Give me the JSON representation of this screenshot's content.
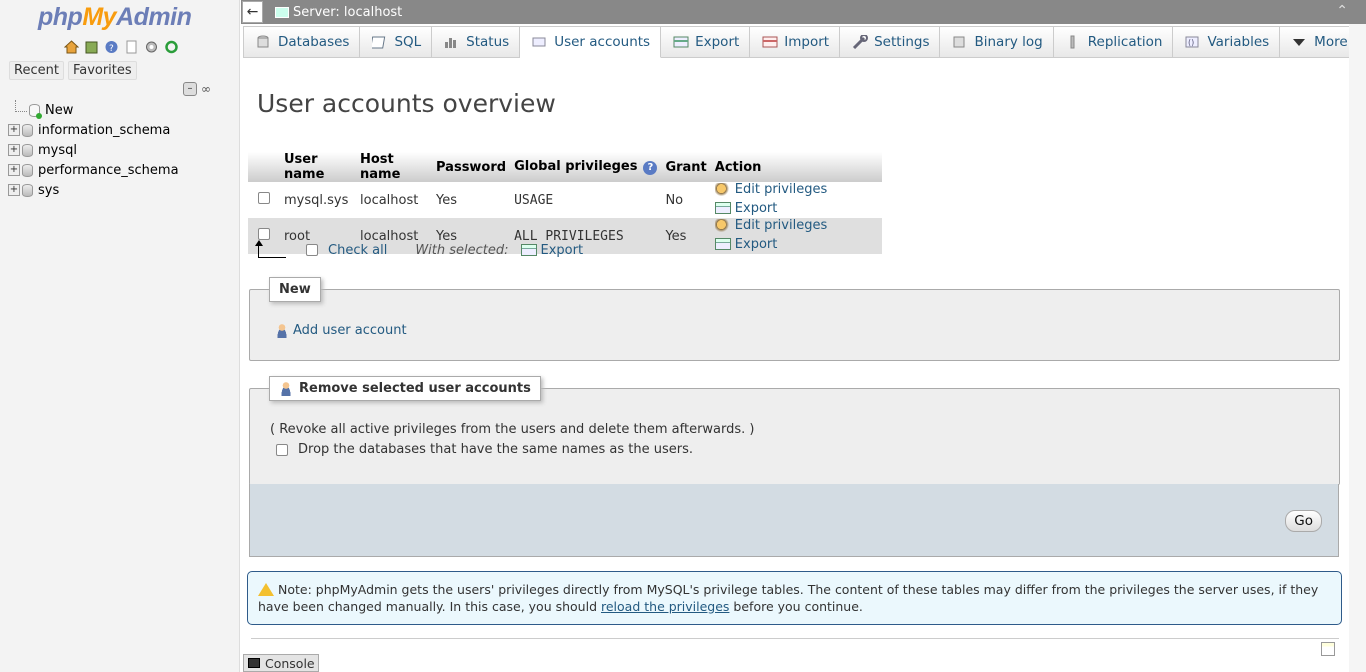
{
  "sidebar": {
    "logo": {
      "php": "php",
      "my": "My",
      "admin": "Admin"
    },
    "nav_icons": [
      "home-icon",
      "database-icon",
      "help-icon",
      "document-icon",
      "gear-icon",
      "reload-icon"
    ],
    "recent_label": "Recent",
    "favorites_label": "Favorites",
    "tree": [
      {
        "label": "New",
        "kind": "new"
      },
      {
        "label": "information_schema",
        "kind": "db"
      },
      {
        "label": "mysql",
        "kind": "db"
      },
      {
        "label": "performance_schema",
        "kind": "db"
      },
      {
        "label": "sys",
        "kind": "db"
      }
    ]
  },
  "topbar": {
    "server": "Server: localhost",
    "collapse_glyph": "←",
    "close_glyph": "⌃"
  },
  "tabs": [
    {
      "label": "Databases",
      "icon": "databases-icon"
    },
    {
      "label": "SQL",
      "icon": "sql-icon"
    },
    {
      "label": "Status",
      "icon": "status-icon"
    },
    {
      "label": "User accounts",
      "icon": "users-icon",
      "active": true
    },
    {
      "label": "Export",
      "icon": "export-icon"
    },
    {
      "label": "Import",
      "icon": "import-icon"
    },
    {
      "label": "Settings",
      "icon": "wrench-icon"
    },
    {
      "label": "Binary log",
      "icon": "binlog-icon"
    },
    {
      "label": "Replication",
      "icon": "replication-icon"
    },
    {
      "label": "Variables",
      "icon": "variables-icon"
    },
    {
      "label": "More",
      "icon": "caret-down-icon"
    }
  ],
  "page_title": "User accounts overview",
  "table": {
    "headers": [
      "User name",
      "Host name",
      "Password",
      "Global privileges",
      "Grant",
      "Action"
    ],
    "rows": [
      {
        "user": "mysql.sys",
        "host": "localhost",
        "password": "Yes",
        "privileges": "USAGE",
        "grant": "No"
      },
      {
        "user": "root",
        "host": "localhost",
        "password": "Yes",
        "privileges": "ALL PRIVILEGES",
        "grant": "Yes"
      }
    ],
    "edit_label": "Edit privileges",
    "export_label": "Export"
  },
  "bulk": {
    "check_all": "Check all",
    "with_selected": "With selected:",
    "export": "Export"
  },
  "new_section": {
    "legend": "New",
    "add_user": "Add user account"
  },
  "remove_section": {
    "legend": "Remove selected user accounts",
    "description": "( Revoke all active privileges from the users and delete them afterwards. )",
    "drop_label": "Drop the databases that have the same names as the users.",
    "go": "Go"
  },
  "notice": {
    "text_before": "Note: phpMyAdmin gets the users' privileges directly from MySQL's privilege tables. The content of these tables may differ from the privileges the server uses, if they have been changed manually. In this case, you should ",
    "link": "reload the privileges",
    "text_after": " before you continue."
  },
  "console": {
    "label": "Console"
  },
  "colors": {
    "accent": "#235a81",
    "topbar": "#888888",
    "notice_bg": "#ebf8fd"
  }
}
